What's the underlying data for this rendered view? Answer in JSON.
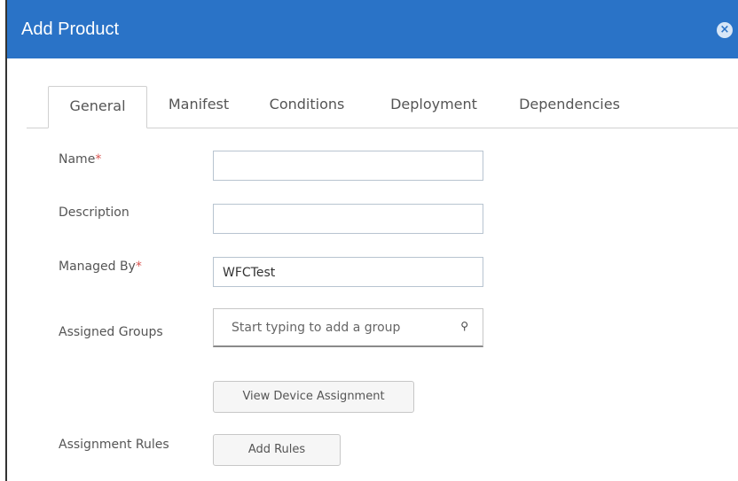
{
  "dialog": {
    "title": "Add Product",
    "close_icon": "×"
  },
  "tabs": [
    {
      "label": "General",
      "active": true
    },
    {
      "label": "Manifest",
      "active": false
    },
    {
      "label": "Conditions",
      "active": false
    },
    {
      "label": "Deployment",
      "active": false
    },
    {
      "label": "Dependencies",
      "active": false
    }
  ],
  "form": {
    "name": {
      "label": "Name",
      "required_mark": "*",
      "value": ""
    },
    "description": {
      "label": "Description",
      "value": ""
    },
    "managed_by": {
      "label": "Managed By",
      "required_mark": "*",
      "value": "WFCTest"
    },
    "assigned_groups": {
      "label": "Assigned Groups",
      "placeholder": "Start typing to add a group",
      "search_icon": "⚲"
    },
    "view_device_assignment": {
      "label": "View Device Assignment"
    },
    "assignment_rules": {
      "label": "Assignment Rules",
      "button_label": "Add Rules"
    }
  },
  "colors": {
    "header_bg": "#2a73c7",
    "required": "#d9534f"
  }
}
